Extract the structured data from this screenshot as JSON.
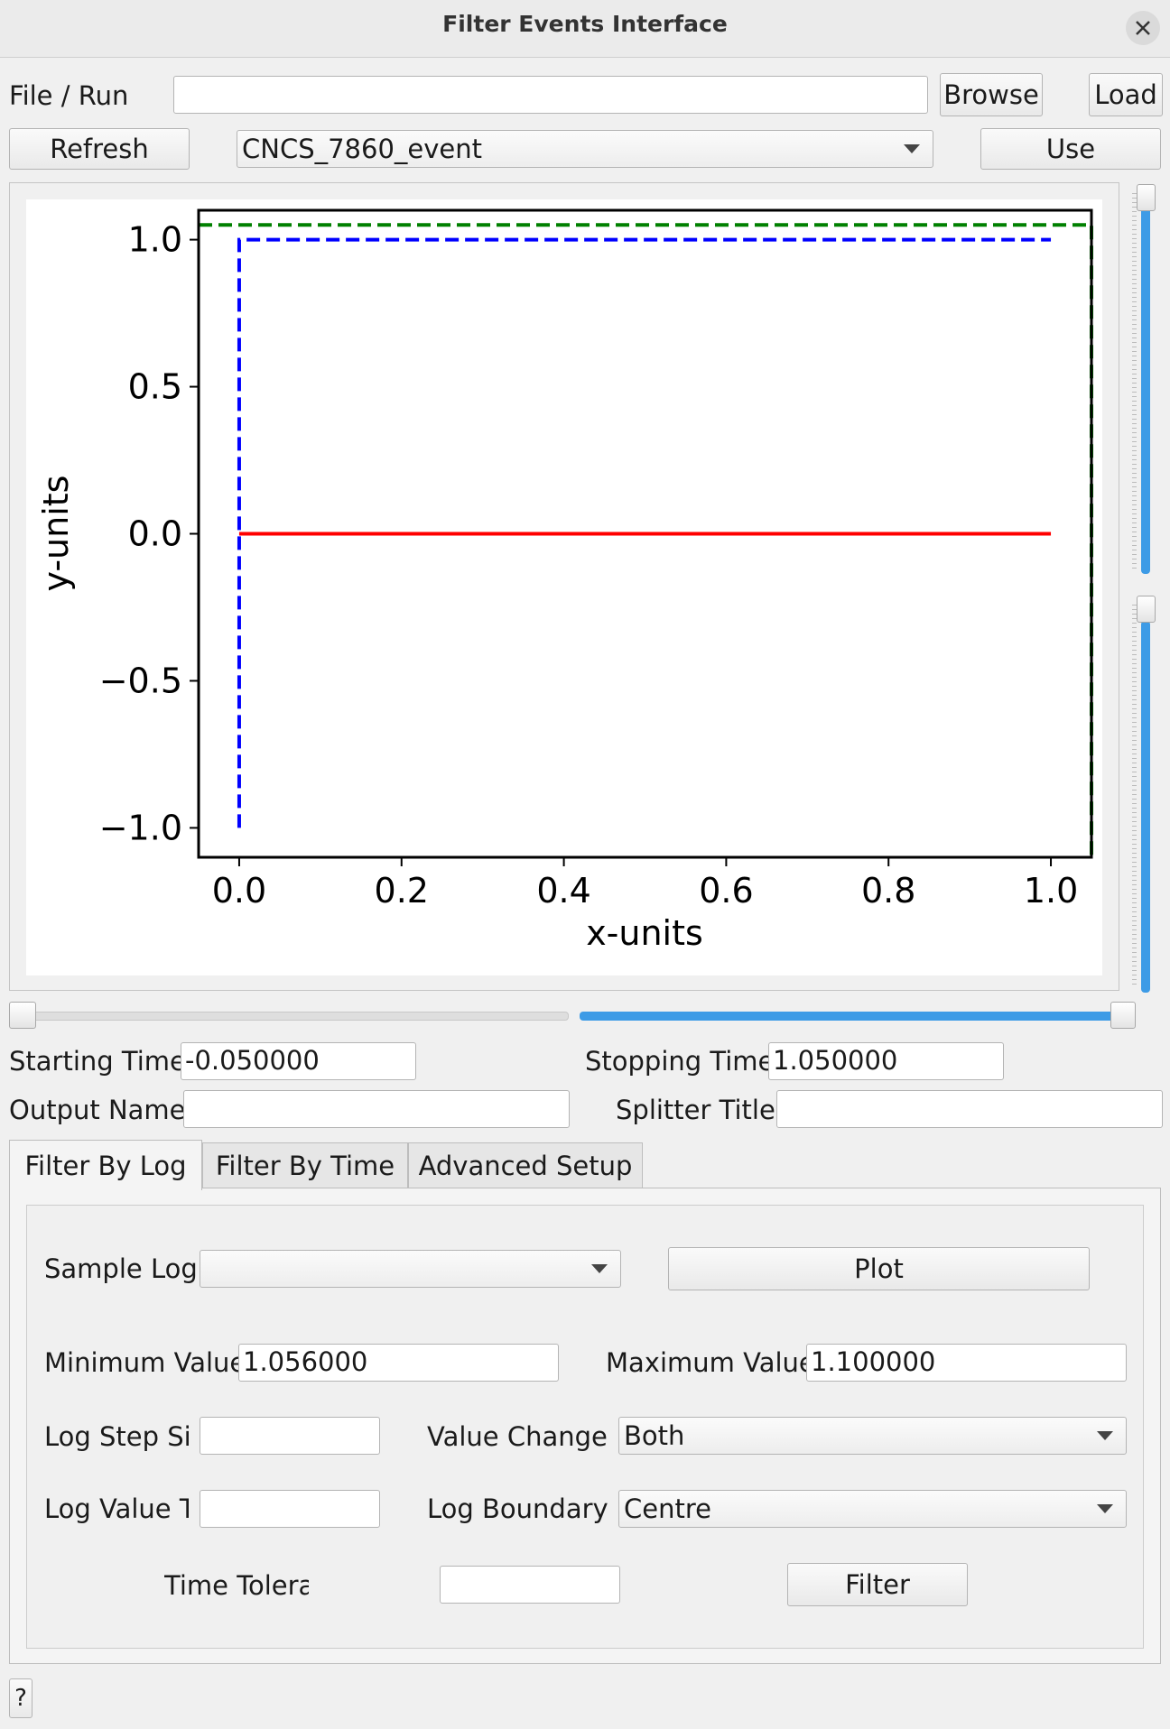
{
  "window": {
    "title": "Filter Events Interface"
  },
  "file_run": {
    "label": "File / Run",
    "value": "",
    "browse_label": "Browse",
    "load_label": "Load"
  },
  "workspace": {
    "refresh_label": "Refresh",
    "selected": "CNCS_7860_event",
    "use_label": "Use"
  },
  "chart_data": {
    "type": "line",
    "xlabel": "x-units",
    "ylabel": "y-units",
    "xlim": [
      -0.05,
      1.05
    ],
    "ylim": [
      -1.1,
      1.1
    ],
    "xticks": [
      "0.0",
      "0.2",
      "0.4",
      "0.6",
      "0.8",
      "1.0"
    ],
    "yticks": [
      "1.0",
      "0.5",
      "0.0",
      "−0.5",
      "−1.0"
    ],
    "grid": false,
    "series": [
      {
        "color": "#ff0000",
        "style": "solid",
        "x": [
          0.0,
          1.0
        ],
        "y": [
          0.0,
          0.0
        ]
      },
      {
        "color": "#0000ff",
        "style": "dashed",
        "x": [
          0.0,
          0.0,
          1.0
        ],
        "y": [
          -1.0,
          1.0,
          1.0
        ]
      },
      {
        "color": "#008000",
        "style": "dashed",
        "x": [
          -0.05,
          1.05,
          1.05
        ],
        "y": [
          1.05,
          1.05,
          -1.1
        ]
      }
    ]
  },
  "sliders": {
    "vertical_upper_level": 1.0,
    "vertical_lower_level": 0.0,
    "horizontal_left_level": 0.0,
    "horizontal_right_level": 1.0
  },
  "time": {
    "start_label": "Starting Time",
    "start_value": "-0.050000",
    "stop_label": "Stopping Time",
    "stop_value": "1.050000"
  },
  "output": {
    "name_label": "Output Name",
    "name_value": "",
    "splitter_label": "Splitter Title",
    "splitter_value": ""
  },
  "tabs": [
    {
      "label": "Filter By Log"
    },
    {
      "label": "Filter By Time"
    },
    {
      "label": "Advanced Setup"
    }
  ],
  "filter_by_log": {
    "sample_log_label": "Sample Log",
    "sample_log_value": "",
    "plot_label": "Plot",
    "min_label": "Minimum Value",
    "min_value": "1.056000",
    "max_label": "Maximum Value",
    "max_value": "1.100000",
    "step_label": "Log Step Size",
    "step_value": "",
    "value_change_label": "Value Change D",
    "value_change_value": "Both",
    "tolerance_label": "Log Value To",
    "tolerance_value": "",
    "boundary_label": "Log Boundary",
    "boundary_value": "Centre",
    "time_tol_label": "Time Toleran",
    "time_tol_value": "",
    "filter_label": "Filter"
  },
  "help": {
    "label": "?"
  },
  "colors": {
    "accent": "#3d9be6",
    "red": "#ff0000",
    "blue": "#0000ff",
    "green": "#008000"
  }
}
